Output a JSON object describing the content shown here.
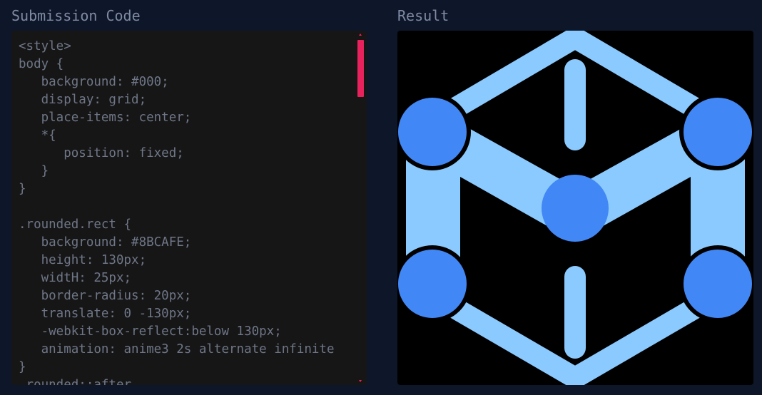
{
  "code_panel": {
    "title": "Submission Code",
    "lines": [
      "<style>",
      "body {",
      "   background: #000;",
      "   display: grid;",
      "   place-items: center;",
      "   *{",
      "      position: fixed;",
      "   }",
      "}",
      "",
      ".rounded.rect {",
      "   background: #8BCAFE;",
      "   height: 130px;",
      "   widtH: 25px;",
      "   border-radius: 20px;",
      "   translate: 0 -130px;",
      "   -webkit-box-reflect:below 130px;",
      "   animation: anime3 2s alternate infinite",
      "}",
      ".rounded::after"
    ]
  },
  "result_panel": {
    "title": "Result"
  },
  "colors": {
    "page_bg": "#0e1629",
    "title_text": "#7f8aa3",
    "code_bg": "#161616",
    "code_text": "#6e7687",
    "scrollbar": "#e8225c",
    "result_bg": "#000000",
    "light_blue": "#8BCAFE",
    "blue_circle": "#4187f5"
  }
}
